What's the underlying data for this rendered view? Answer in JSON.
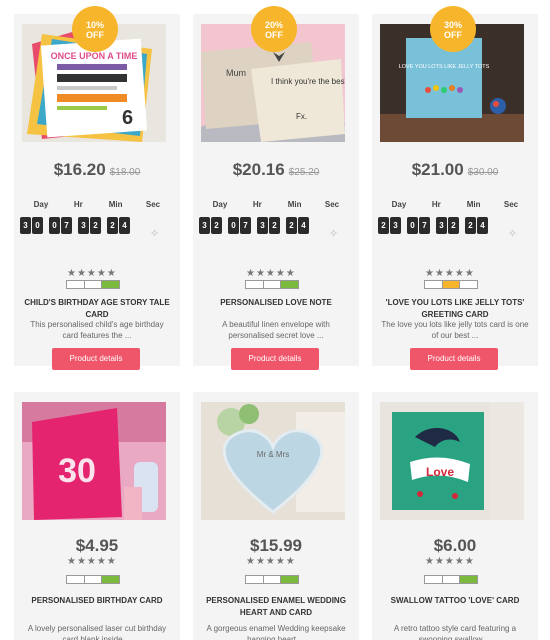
{
  "timer_labels": [
    "Day",
    "Hr",
    "Min",
    "Sec"
  ],
  "button_label": "Product details",
  "stars": "★★★★★",
  "products": [
    {
      "badge_pct": "10%",
      "badge_off": "OFF",
      "price": "$16.20",
      "old_price": "$18.00",
      "digits": [
        "3",
        "0",
        "0",
        "7",
        "3",
        "2",
        "2",
        "4"
      ],
      "meter_color": "#7cba3d",
      "title": "CHILD'S BIRTHDAY AGE STORY TALE CARD",
      "desc": "This personalised child's age birthday card features the ...",
      "img_text": "ONCE UPON A TIME"
    },
    {
      "badge_pct": "20%",
      "badge_off": "OFF",
      "price": "$20.16",
      "old_price": "$25.20",
      "digits": [
        "3",
        "2",
        "0",
        "7",
        "3",
        "2",
        "2",
        "4"
      ],
      "meter_color": "#7cba3d",
      "title": "PERSONALISED LOVE NOTE",
      "desc": "A beautiful linen envelope with personalised secret love ...",
      "img_text": "I think you're the best"
    },
    {
      "badge_pct": "30%",
      "badge_off": "OFF",
      "price": "$21.00",
      "old_price": "$30.00",
      "digits": [
        "2",
        "3",
        "0",
        "7",
        "3",
        "2",
        "2",
        "4"
      ],
      "meter_color": "#f7b52b",
      "title": "'LOVE YOU LOTS LIKE JELLY TOTS' GREETING CARD",
      "desc": "The love you lots like jelly tots card is one of our best ...",
      "img_text": "LOVE YOU LOTS LIKE JELLY TOTS"
    },
    {
      "price": "$4.95",
      "meter_color": "#7cba3d",
      "title": "PERSONALISED BIRTHDAY CARD",
      "desc": "A lovely personalised laser cut birthday card blank inside ...",
      "img_text": "30"
    },
    {
      "price": "$15.99",
      "meter_color": "#7cba3d",
      "title": "PERSONALISED ENAMEL WEDDING HEART AND CARD",
      "desc": "A gorgeous enamel Wedding keepsake hanging heart ...",
      "img_text": "Mr & Mrs"
    },
    {
      "price": "$6.00",
      "meter_color": "#7cba3d",
      "title": "SWALLOW TATTOO 'LOVE' CARD",
      "desc": "A retro tattoo style card featuring a swooping swallow ...",
      "img_text": "Love"
    }
  ]
}
